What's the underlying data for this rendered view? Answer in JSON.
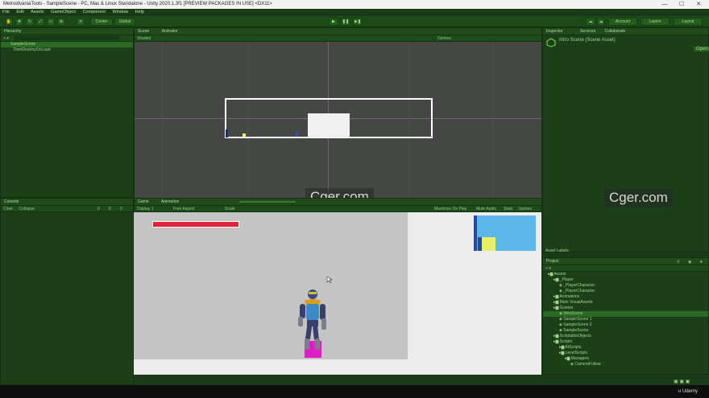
{
  "window": {
    "title": "MetroidvaniaTools - SampleScene - PC, Mac & Linux Standalone - Unity 2020.1.3f1 [PREVIEW PACKAGES IN USE] <DX11>",
    "minimize": "—",
    "maximize": "☐",
    "close": "✕"
  },
  "menu": [
    "File",
    "Edit",
    "Assets",
    "GameObject",
    "Component",
    "Window",
    "Help"
  ],
  "toolbar": {
    "center_label": "Center",
    "global_label": "Global",
    "account_label": "Account",
    "layers_label": "Layers",
    "layout_label": "Layout"
  },
  "hierarchy": {
    "tab": "Hierarchy",
    "items": [
      "SampleScene",
      "DontDestroyOnLoad"
    ]
  },
  "scene": {
    "tab_scene": "Scene",
    "tab_animator": "Animator",
    "shaded": "Shaded",
    "gizmos": "Gizmos"
  },
  "console": {
    "tab": "Console",
    "clear": "Clear",
    "collapse": "Collapse",
    "count1": "0",
    "count2": "0",
    "count3": "0"
  },
  "game": {
    "tab_game": "Game",
    "tab_animation": "Animation",
    "display": "Display 1",
    "aspect": "Free Aspect",
    "scale_label": "Scale",
    "maximize": "Maximize On Play",
    "mute": "Mute Audio",
    "stats": "Stats",
    "gizmos": "Gizmos"
  },
  "inspector": {
    "tab_inspector": "Inspector",
    "tab_services": "Services",
    "tab_collab": "Collaborate",
    "title": "Intro Scene (Scene Asset)",
    "open": "Open",
    "asset_labels": "Asset Labels"
  },
  "project": {
    "tab": "Project",
    "tree": [
      {
        "label": "Assets",
        "depth": 0
      },
      {
        "label": "_Player",
        "depth": 1
      },
      {
        "label": "_PlayerCharacter",
        "depth": 2
      },
      {
        "label": "_PlayerCharacter",
        "depth": 2
      },
      {
        "label": "Animations",
        "depth": 1
      },
      {
        "label": "Main VisualAssets",
        "depth": 1
      },
      {
        "label": "Scenes",
        "depth": 1
      },
      {
        "label": "IntroScene",
        "depth": 2
      },
      {
        "label": "SampleScene 1",
        "depth": 2
      },
      {
        "label": "SampleScene 2",
        "depth": 2
      },
      {
        "label": "SampleScene",
        "depth": 2
      },
      {
        "label": "ScriptableObjects",
        "depth": 1
      },
      {
        "label": "Scripts",
        "depth": 1
      },
      {
        "label": "AIScripts",
        "depth": 2
      },
      {
        "label": "LevelScripts",
        "depth": 2
      },
      {
        "label": "Managers",
        "depth": 3
      },
      {
        "label": "CameraFollow",
        "depth": 4
      }
    ]
  },
  "watermark": "Cger.com",
  "udemy": "Udemy",
  "colors": {
    "accent": "#2e7a28",
    "health_bar": "#e0213a",
    "minimap": "#5cb7e8",
    "minimap_yellow": "#e8ef66",
    "minimap_blue": "#2a44a8",
    "player_block": "#e01ec8"
  }
}
